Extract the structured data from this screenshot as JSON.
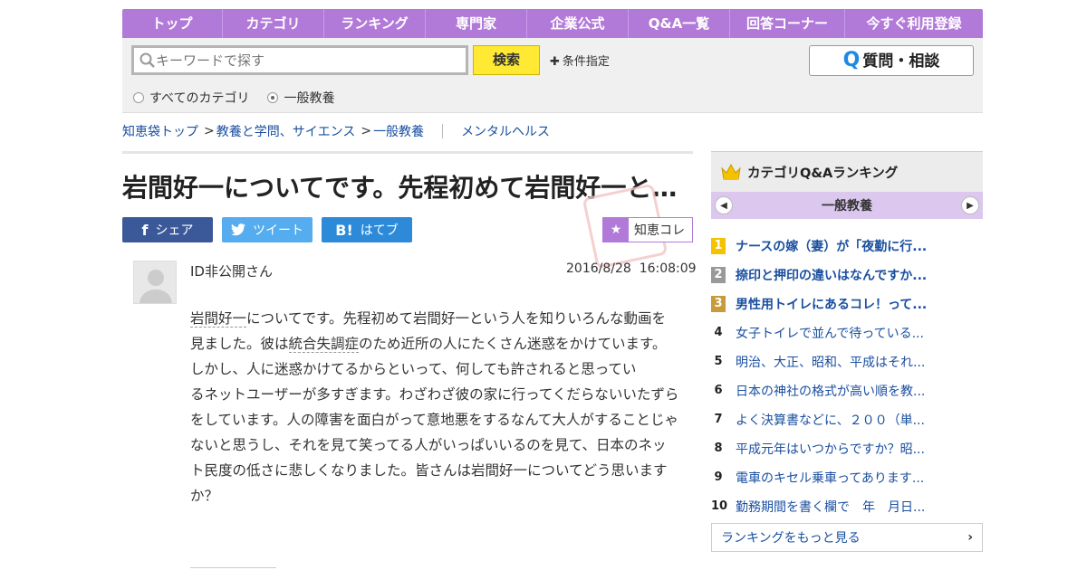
{
  "nav": [
    "トップ",
    "カテゴリ",
    "ランキング",
    "専門家",
    "企業公式",
    "Q&A一覧",
    "回答コーナー",
    "今すぐ利用登録"
  ],
  "search": {
    "placeholder": "キーワードで探す",
    "button": "検索",
    "conditions": "条件指定",
    "ask_button": "質問・相談",
    "ask_icon": "Q",
    "scope_all": "すべてのカテゴリ",
    "scope_current": "一般教養"
  },
  "breadcrumb": {
    "home": "知恵袋トップ",
    "sep": ">",
    "cat1": "教養と学問、サイエンス",
    "cat2": "一般教養",
    "related": "メンタルヘルス"
  },
  "question": {
    "title": "岩間好一についてです。先程初めて岩間好一と…",
    "author": "ID非公開さん",
    "date": "2016/8/28",
    "time": "16:08:09",
    "p1_kw": "岩間好一",
    "p1_rest": "についてです。先程初めて岩間好一という人を知りいろんな動画を見ました。彼は",
    "p1_kw2": "統合失調症",
    "p1_rest2": "のため近所の人にたくさん迷惑をかけています。しかし、人に迷惑かけてるからといって、何しても許されると思ってい",
    "p2": "るネットユーザーが多すぎます。わざわざ彼の家に行ってくだらないいたずらをしています。人の障害を面白がって意地悪をするなんて大人がすることじゃないと思うし、それを見て笑ってる人がいっぱいいるのを見て、日本のネット民度の低さに悲しくなりました。皆さんは岩間好一についてどう思いますか？"
  },
  "share": {
    "facebook": "シェア",
    "twitter": "ツイート",
    "hatena": "はてブ",
    "chiekore": "知恵コレ"
  },
  "ranking": {
    "title": "カテゴリQ&Aランキング",
    "category": "一般教養",
    "items": [
      {
        "num": "1",
        "text": "ナースの嫁（妻）が「夜勤に行..."
      },
      {
        "num": "2",
        "text": "捺印と押印の違いはなんですか..."
      },
      {
        "num": "3",
        "text": "男性用トイレにあるコレ！って..."
      },
      {
        "num": "4",
        "text": "女子トイレで並んで待っている..."
      },
      {
        "num": "5",
        "text": "明治、大正、昭和、平成はそれ..."
      },
      {
        "num": "6",
        "text": "日本の神社の格式が高い順を教..."
      },
      {
        "num": "7",
        "text": "よく決算書などに、２００（単..."
      },
      {
        "num": "8",
        "text": "平成元年はいつからですか？昭..."
      },
      {
        "num": "9",
        "text": "電車のキセル乗車ってあります..."
      },
      {
        "num": "10",
        "text": "勤務期間を書く欄で　年　月日..."
      }
    ],
    "more": "ランキングをもっと見る"
  },
  "colors": {
    "brand_purple": "#b27ad8",
    "link_blue": "#1a4fa0",
    "search_yellow": "#ffe933"
  }
}
